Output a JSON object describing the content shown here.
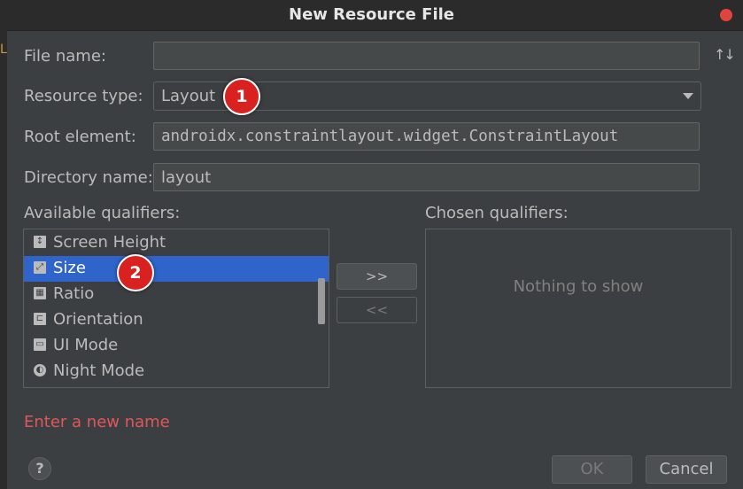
{
  "window": {
    "title": "New Resource File"
  },
  "background_text": "L",
  "form": {
    "file_name": {
      "label": "File name:",
      "value": ""
    },
    "sort_icon": "↑↓",
    "resource_type": {
      "label": "Resource type:",
      "value": "Layout"
    },
    "root_element": {
      "label": "Root element:",
      "value": "androidx.constraintlayout.widget.ConstraintLayout"
    },
    "directory_name": {
      "label": "Directory name:",
      "value": "layout"
    }
  },
  "qualifiers": {
    "available_label": "Available qualifiers:",
    "chosen_label": "Chosen qualifiers:",
    "empty_text": "Nothing to show",
    "items": [
      {
        "label": "Screen Height",
        "icon": "screen-height-icon",
        "glyph": "↕"
      },
      {
        "label": "Size",
        "icon": "size-icon",
        "glyph": "⤢",
        "selected": true
      },
      {
        "label": "Ratio",
        "icon": "ratio-icon",
        "glyph": "▦"
      },
      {
        "label": "Orientation",
        "icon": "orientation-icon",
        "glyph": "⊏"
      },
      {
        "label": "UI Mode",
        "icon": "ui-mode-icon",
        "glyph": "▭"
      },
      {
        "label": "Night Mode",
        "icon": "night-mode-icon",
        "glyph": "◐"
      }
    ],
    "add_button": ">>",
    "remove_button": "<<"
  },
  "annotations": {
    "badge1": "1",
    "badge2": "2"
  },
  "status": {
    "error": "Enter a new name"
  },
  "footer": {
    "help": "?",
    "ok": "OK",
    "cancel": "Cancel"
  },
  "colors": {
    "selection": "#2f65ca",
    "error": "#e0575b",
    "badge": "#d9211f"
  }
}
